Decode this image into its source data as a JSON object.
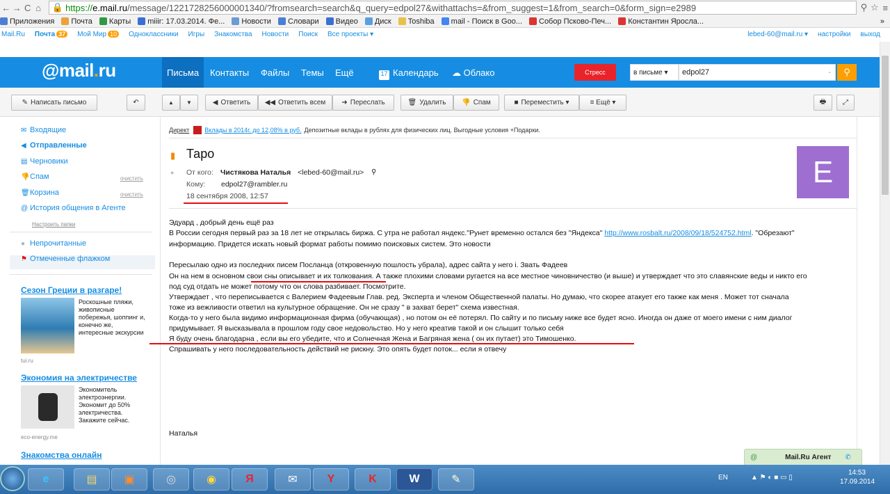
{
  "browser": {
    "url_https": "https://",
    "url_host": "e.mail.ru",
    "url_rest": "/message/1221728256000001340/?fromsearch=search&q_query=edpol27&withattachs=&from_suggest=1&from_search=0&form_sign=e2989",
    "bookmarks": [
      "Приложения",
      "Почта",
      "Карты",
      "miiir: 17.03.2014. Фе...",
      "Новости",
      "Словари",
      "Видео",
      "Диск",
      "Toshiba",
      "mail - Поиск в Goo...",
      "Собор Псково-Печ...",
      "Константин Яросла..."
    ],
    "more": "»"
  },
  "portal": {
    "items": [
      "Mail.Ru",
      "Почта",
      "Мой Мир",
      "Одноклассники",
      "Игры",
      "Знакомства",
      "Новости",
      "Поиск",
      "Все проекты ▾"
    ],
    "mail_badge": "37",
    "mir_badge": "10",
    "user": "lebed-60@mail.ru ▾",
    "settings": "настройки",
    "logout": "выход"
  },
  "header": {
    "logo_at": "@",
    "logo_mail": "mail",
    "logo_dot": ".",
    "logo_ru": "ru",
    "nav": [
      "Письма",
      "Контакты",
      "Файлы",
      "Темы",
      "Ещё"
    ],
    "calendar": "Календарь",
    "cloud": "Облако",
    "stress": "Стресс",
    "search_scope": "в письме ▾",
    "search_value": "edpol27"
  },
  "toolbar": {
    "compose": "Написать письмо",
    "reply": "Ответить",
    "reply_all": "Ответить всем",
    "forward": "Переслать",
    "delete": "Удалить",
    "spam": "Спам",
    "move": "Переместить ▾",
    "more": "≡  Ещё ▾"
  },
  "sidebar": {
    "folders": [
      {
        "label": "Входящие",
        "icon": "inbox-icon"
      },
      {
        "label": "Отправленные",
        "icon": "sent-icon"
      },
      {
        "label": "Черновики",
        "icon": "drafts-icon"
      },
      {
        "label": "Спам",
        "icon": "spam-icon",
        "action": "очистить"
      },
      {
        "label": "Корзина",
        "icon": "trash-icon",
        "action": "очистить"
      },
      {
        "label": "История общения в Агенте",
        "icon": "agent-icon"
      }
    ],
    "setup": "Настроить папки",
    "unread": "Непрочитанные",
    "flagged": "Отмеченные флажком",
    "ads": [
      {
        "title": "Сезон Греции в разгаре!",
        "text": "Роскошные пляжи, живописные побережья, шоппинг и, конечно же, интересные экскурсии",
        "source": "tui.ru"
      },
      {
        "title": "Экономия на электричестве",
        "text": "Экономитель электроэнергии. Экономит до 50% электричества. Закажите сейчас.",
        "source": "eco-energy.me"
      },
      {
        "title": "Знакомства онлайн",
        "text": "",
        "source": ""
      }
    ]
  },
  "message": {
    "ad_label": "Директ",
    "ad_text": "Вклады в 2014г. до 12,08% в руб.",
    "ad_rest": "Депозитные вклады в рублях для физических лиц. Выгодные условия +Подарки.",
    "subject": "Таро",
    "from_label": "От кого:",
    "from_name": "Чистякова Наталья",
    "from_email": "<lebed-60@mail.ru>",
    "to_label": "Кому:",
    "to_email": "edpol27@rambler.ru",
    "date": "18 сентября 2008, 12:57",
    "avatar_letter": "E",
    "avatar_color": "#9e6fd0",
    "body": {
      "l1": "Эдуард , добрый день ещё раз",
      "l2a": "В России сегодня первый раз за 18 лет не открылась биржа. С утра не работал яндекс.\"Рунет временно остался без \"Яндекса\" ",
      "l2link": "http://www.rosbalt.ru/2008/09/18/524752.html",
      "l2b": ". \"Обрезают\"",
      "l3": "информацию. Придется искать новый формат работы помимо поисковых систем. Это новости",
      "l4": "Пересылаю одно из последних писем Посланца (откровенную пошлость убрала), адрес сайта у него                  i. Звать         Фадеев",
      "l5a": "Он на нем в основном ",
      "l5u": "свои сны описывает и их толкования",
      "l5b": ". А также плохими словами ругается на все местное чиновничество (и выше) и утверждает что это славянские веды и никто его",
      "l6": "под суд отдать не может потому что он слова разбивает. Посмотрите.",
      "l7": "Утверждает , что переписывается с Валерием Фадеевым Глав. ред. Эксперта и членом Общественной палаты. Но думаю, что скорее атакует его также как меня . Может тот сначала",
      "l8": "тоже из вежливости ответил на культурное обращение. Он не сразу \" в захват берет\" схема известная.",
      "l9": "Когда-то у него была видимо информационная фирма (обучающая) , но потом он её потерял. По сайту и по письму ниже все будет ясно. Иногда он даже от моего имени с ним диалог",
      "l10": "придумывает. Я высказывала в прошлом году свое недовольство. Но у него креатив такой и он слышит только себя",
      "l11": "Я буду очень благодарна , если вы его убедите, что и Солнечная Жена и Багряная жена ( он их путает) это Тимошенко.",
      "l12": "Спрашивать у него последовательность действий не рискну. Это опять будет поток... если я отвечу",
      "sign": "Наталья"
    }
  },
  "agent": {
    "label": "Mail.Ru Агент"
  },
  "taskbar": {
    "lang": "EN",
    "time": "14:53",
    "date": "17.09.2014"
  }
}
